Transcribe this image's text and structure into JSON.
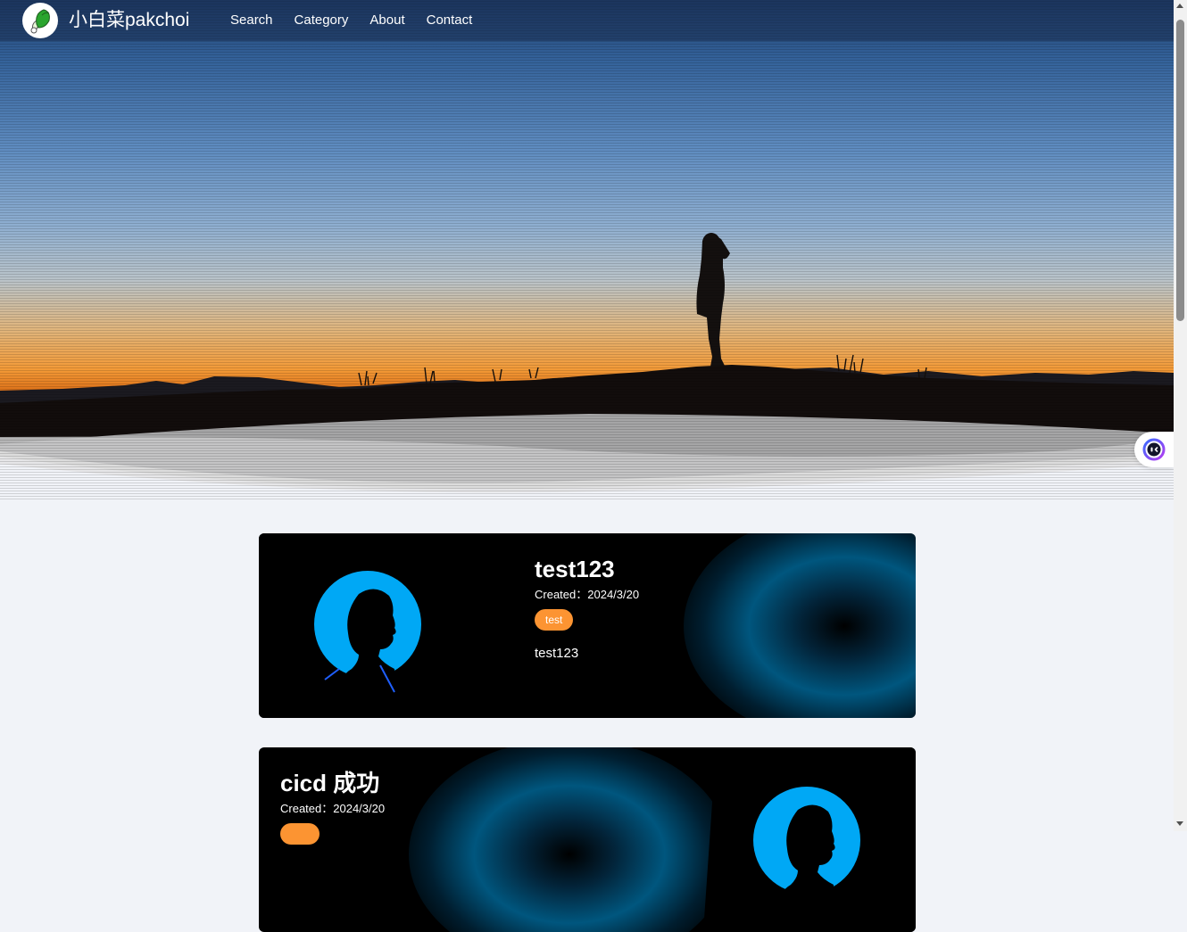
{
  "header": {
    "site_title": "小白菜pakchoi",
    "nav": [
      "Search",
      "Category",
      "About",
      "Contact"
    ]
  },
  "posts": [
    {
      "title": "test123",
      "created_label": "Created：",
      "created_date": "2024/3/20",
      "tag": "test",
      "excerpt": "test123"
    },
    {
      "title": "cicd 成功",
      "created_label": "Created：",
      "created_date": "2024/3/20",
      "tag": ""
    }
  ],
  "colors": {
    "tag_bg": "#fc9432",
    "avatar_blue": "#00a8f5",
    "page_bg": "#f1f3f8"
  },
  "icons": {
    "logo": "pakchoi-logo-icon",
    "floating": "assistant-face-icon"
  }
}
